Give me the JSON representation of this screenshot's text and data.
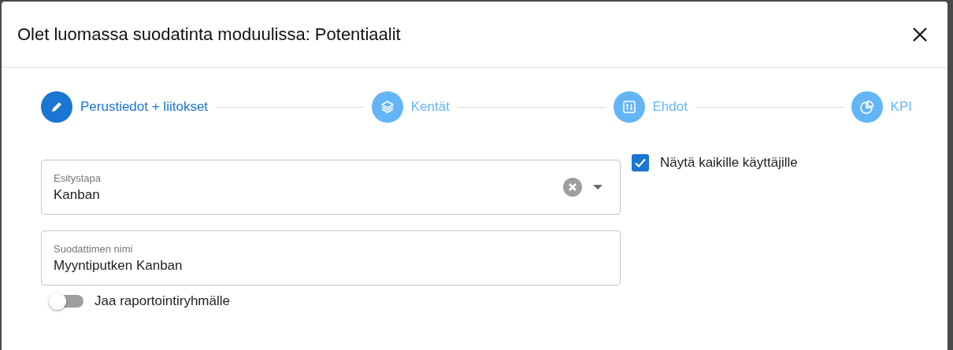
{
  "dialog": {
    "title": "Olet luomassa suodatinta moduulissa: Potentiaalit"
  },
  "steps": [
    {
      "label": "Perustiedot + liitokset",
      "selected": true
    },
    {
      "label": "Kentät",
      "selected": false
    },
    {
      "label": "Ehdot",
      "selected": false
    },
    {
      "label": "KPI",
      "selected": false
    }
  ],
  "fields": [
    {
      "kind": "select",
      "label": "Esitystapa",
      "value": "Kanban"
    },
    {
      "kind": "text",
      "label": "Suodattimen nimi",
      "value": "Myyntiputken Kanban"
    }
  ],
  "share_toggle": {
    "label": "Jaa raportointiryhmälle",
    "on": false
  },
  "show_all_checkbox": {
    "label": "Näytä kaikille käyttäjille",
    "checked": true
  }
}
